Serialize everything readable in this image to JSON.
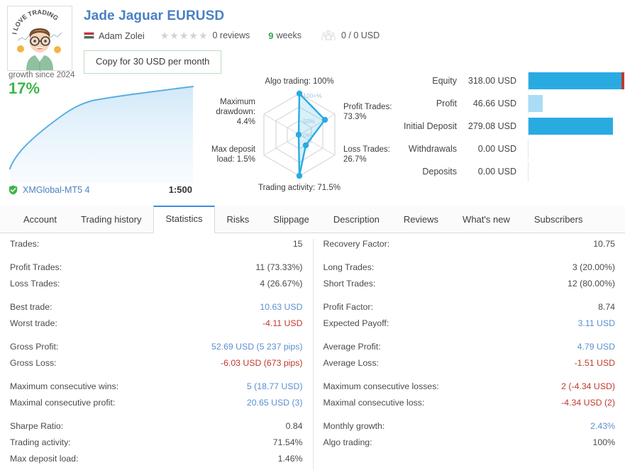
{
  "header": {
    "avatar_alt": "I LOVE TRADING",
    "title": "Jade Jaguar EURUSD",
    "author": "Adam Zolei",
    "flag": "hungary-flag-icon",
    "flag_colors": [
      "#cd2a3e",
      "#ffffff",
      "#436f4d"
    ],
    "rating_stars": "★★★★★",
    "rating_count": 0,
    "reviews_label": "0 reviews",
    "weeks_number": "9",
    "weeks_label": "weeks",
    "subscribers_icon": "subscribers-icon",
    "subscribers_value": "0 / 0 USD",
    "copy_button": "Copy for 30 USD per month"
  },
  "growth": {
    "label": "growth since 2024",
    "percent": "17%",
    "broker": "XMGlobal-MT5 4",
    "verified_icon": "verified-shield-icon",
    "leverage": "1:500",
    "accent_line": "#5aaee0",
    "accent_fill": "#ddeefb"
  },
  "radar": {
    "accent": "#29abe2",
    "ring_labels": [
      "100+%",
      "50%",
      "0%"
    ],
    "axes": [
      {
        "label": "Algo trading: 100%",
        "value": 100
      },
      {
        "label": "Profit Trades: 73.3%",
        "value": 73.3
      },
      {
        "label": "Loss Trades: 26.7%",
        "value": 26.7
      },
      {
        "label": "Trading activity: 71.5%",
        "value": 71.5
      },
      {
        "label": "Max deposit load: 1.5%",
        "value": 1.5
      },
      {
        "label": "Maximum drawdown: 4.4%",
        "value": 4.4
      }
    ],
    "axis_lines": {
      "algo": [
        "Algo trading: 100%"
      ],
      "profit": [
        "Profit Trades:",
        "73.3%"
      ],
      "loss": [
        "Loss Trades:",
        "26.7%"
      ],
      "activity": [
        "Trading activity: 71.5%"
      ],
      "maxdep": [
        "Max deposit",
        "load: 1.5%"
      ],
      "drawdown": [
        "Maximum",
        "drawdown:",
        "4.4%"
      ]
    }
  },
  "equity": {
    "bar_color": "#29abe2",
    "bar_color_light": "#abdcf5",
    "bar_color_red": "#c0392b",
    "rows": [
      {
        "label": "Equity",
        "value": "318.00 USD",
        "pct": 100,
        "style": "solid"
      },
      {
        "label": "Profit",
        "value": "46.66 USD",
        "pct": 14.7,
        "style": "light"
      },
      {
        "label": "Initial Deposit",
        "value": "279.08 USD",
        "pct": 87.8,
        "style": "solid"
      },
      {
        "label": "Withdrawals",
        "value": "0.00 USD",
        "pct": 0,
        "style": "none"
      },
      {
        "label": "Deposits",
        "value": "0.00 USD",
        "pct": 0,
        "style": "none"
      }
    ]
  },
  "tabs": {
    "active": "Statistics",
    "items": [
      "Account",
      "Trading history",
      "Statistics",
      "Risks",
      "Slippage",
      "Description",
      "Reviews",
      "What's new",
      "Subscribers"
    ]
  },
  "statistics": {
    "left": [
      {
        "key": "Trades:",
        "value": "15",
        "color": "grey",
        "gap_after": true
      },
      {
        "key": "Profit Trades:",
        "value": "11 (73.33%)",
        "color": "grey"
      },
      {
        "key": "Loss Trades:",
        "value": "4 (26.67%)",
        "color": "grey",
        "gap_after": true
      },
      {
        "key": "Best trade:",
        "value": "10.63 USD",
        "color": "blue"
      },
      {
        "key": "Worst trade:",
        "value": "-4.11 USD",
        "color": "red",
        "gap_after": true
      },
      {
        "key": "Gross Profit:",
        "value": "52.69 USD (5 237 pips)",
        "color": "blue"
      },
      {
        "key": "Gross Loss:",
        "value": "-6.03 USD (673 pips)",
        "color": "red",
        "gap_after": true
      },
      {
        "key": "Maximum consecutive wins:",
        "value": "5 (18.77 USD)",
        "color": "blue"
      },
      {
        "key": "Maximal consecutive profit:",
        "value": "20.65 USD (3)",
        "color": "blue",
        "gap_after": true
      },
      {
        "key": "Sharpe Ratio:",
        "value": "0.84",
        "color": "grey"
      },
      {
        "key": "Trading activity:",
        "value": "71.54%",
        "color": "grey"
      },
      {
        "key": "Max deposit load:",
        "value": "1.46%",
        "color": "grey"
      }
    ],
    "right": [
      {
        "key": "Recovery Factor:",
        "value": "10.75",
        "color": "grey",
        "gap_after": true
      },
      {
        "key": "Long Trades:",
        "value": "3 (20.00%)",
        "color": "grey"
      },
      {
        "key": "Short Trades:",
        "value": "12 (80.00%)",
        "color": "grey",
        "gap_after": true
      },
      {
        "key": "Profit Factor:",
        "value": "8.74",
        "color": "grey"
      },
      {
        "key": "Expected Payoff:",
        "value": "3.11 USD",
        "color": "blue",
        "gap_after": true
      },
      {
        "key": "Average Profit:",
        "value": "4.79 USD",
        "color": "blue"
      },
      {
        "key": "Average Loss:",
        "value": "-1.51 USD",
        "color": "red",
        "gap_after": true
      },
      {
        "key": "Maximum consecutive losses:",
        "value": "2 (-4.34 USD)",
        "color": "red"
      },
      {
        "key": "Maximal consecutive loss:",
        "value": "-4.34 USD (2)",
        "color": "red",
        "gap_after": true
      },
      {
        "key": "Monthly growth:",
        "value": "2.43%",
        "color": "blue"
      },
      {
        "key": "Algo trading:",
        "value": "100%",
        "color": "grey"
      }
    ]
  }
}
